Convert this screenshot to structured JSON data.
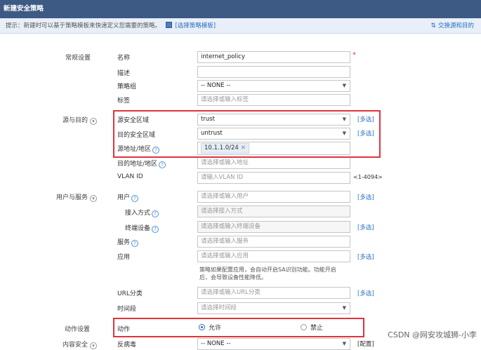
{
  "window": {
    "title": "新建安全策略"
  },
  "hint": {
    "text": "提示：新建时可以基于策略模板来快速定义您需要的策略。",
    "template_link": "[选择策略模板]",
    "swap_link": "交换源和目的",
    "swap_icon": "swap-arrows-icon"
  },
  "sections": {
    "general": "常规设置",
    "source_dest": "源与目的",
    "user_service": "用户与服务",
    "action": "动作设置",
    "content": "内容安全"
  },
  "labels": {
    "name": "名称",
    "desc": "描述",
    "group": "策略组",
    "tag": "标签",
    "src_zone": "源安全区域",
    "dst_zone": "目的安全区域",
    "src_addr": "源地址/地区",
    "dst_addr": "目的地址/地区",
    "vlan": "VLAN ID",
    "user": "用户",
    "access_mode": "接入方式",
    "terminal": "终端设备",
    "service": "服务",
    "app": "应用",
    "url": "URL分类",
    "time": "时间段",
    "action": "动作",
    "antivirus": "反病毒"
  },
  "fields": {
    "name": "internet_policy",
    "desc": "",
    "group": "-- NONE --",
    "tag_ph": "请选择或输入标签",
    "src_zone": "trust",
    "dst_zone": "untrust",
    "src_addr_chip": "10.1.1.0/24",
    "dst_addr_ph": "请选择或输入地址",
    "vlan_ph": "请输入VLAN ID",
    "vlan_range": "<1-4094>",
    "user_ph": "请选择或输入用户",
    "access_ph": "请选择接入方式",
    "terminal_ph": "请选择或输入终端设备",
    "service_ph": "请选择或输入服务",
    "app_ph": "请选择或输入应用",
    "app_note_1": "策略如果配置应用，会自动开启SA识别功能。功能开启",
    "app_note_2": "后，会导致设备性能降低。",
    "url_ph": "请选择或输入URL分类",
    "time_ph": "请选择时间段",
    "action_allow": "允许",
    "action_deny": "禁止",
    "antivirus": "-- NONE --",
    "antivirus_btn": "[配置]"
  },
  "multi_select": "[多选]",
  "required_mark": "*",
  "watermark": "CSDN @网安攻城狮-小李",
  "colors": {
    "title_bar": "#3d5a85",
    "highlight": "#e0333c",
    "link": "#2a6fc0"
  }
}
